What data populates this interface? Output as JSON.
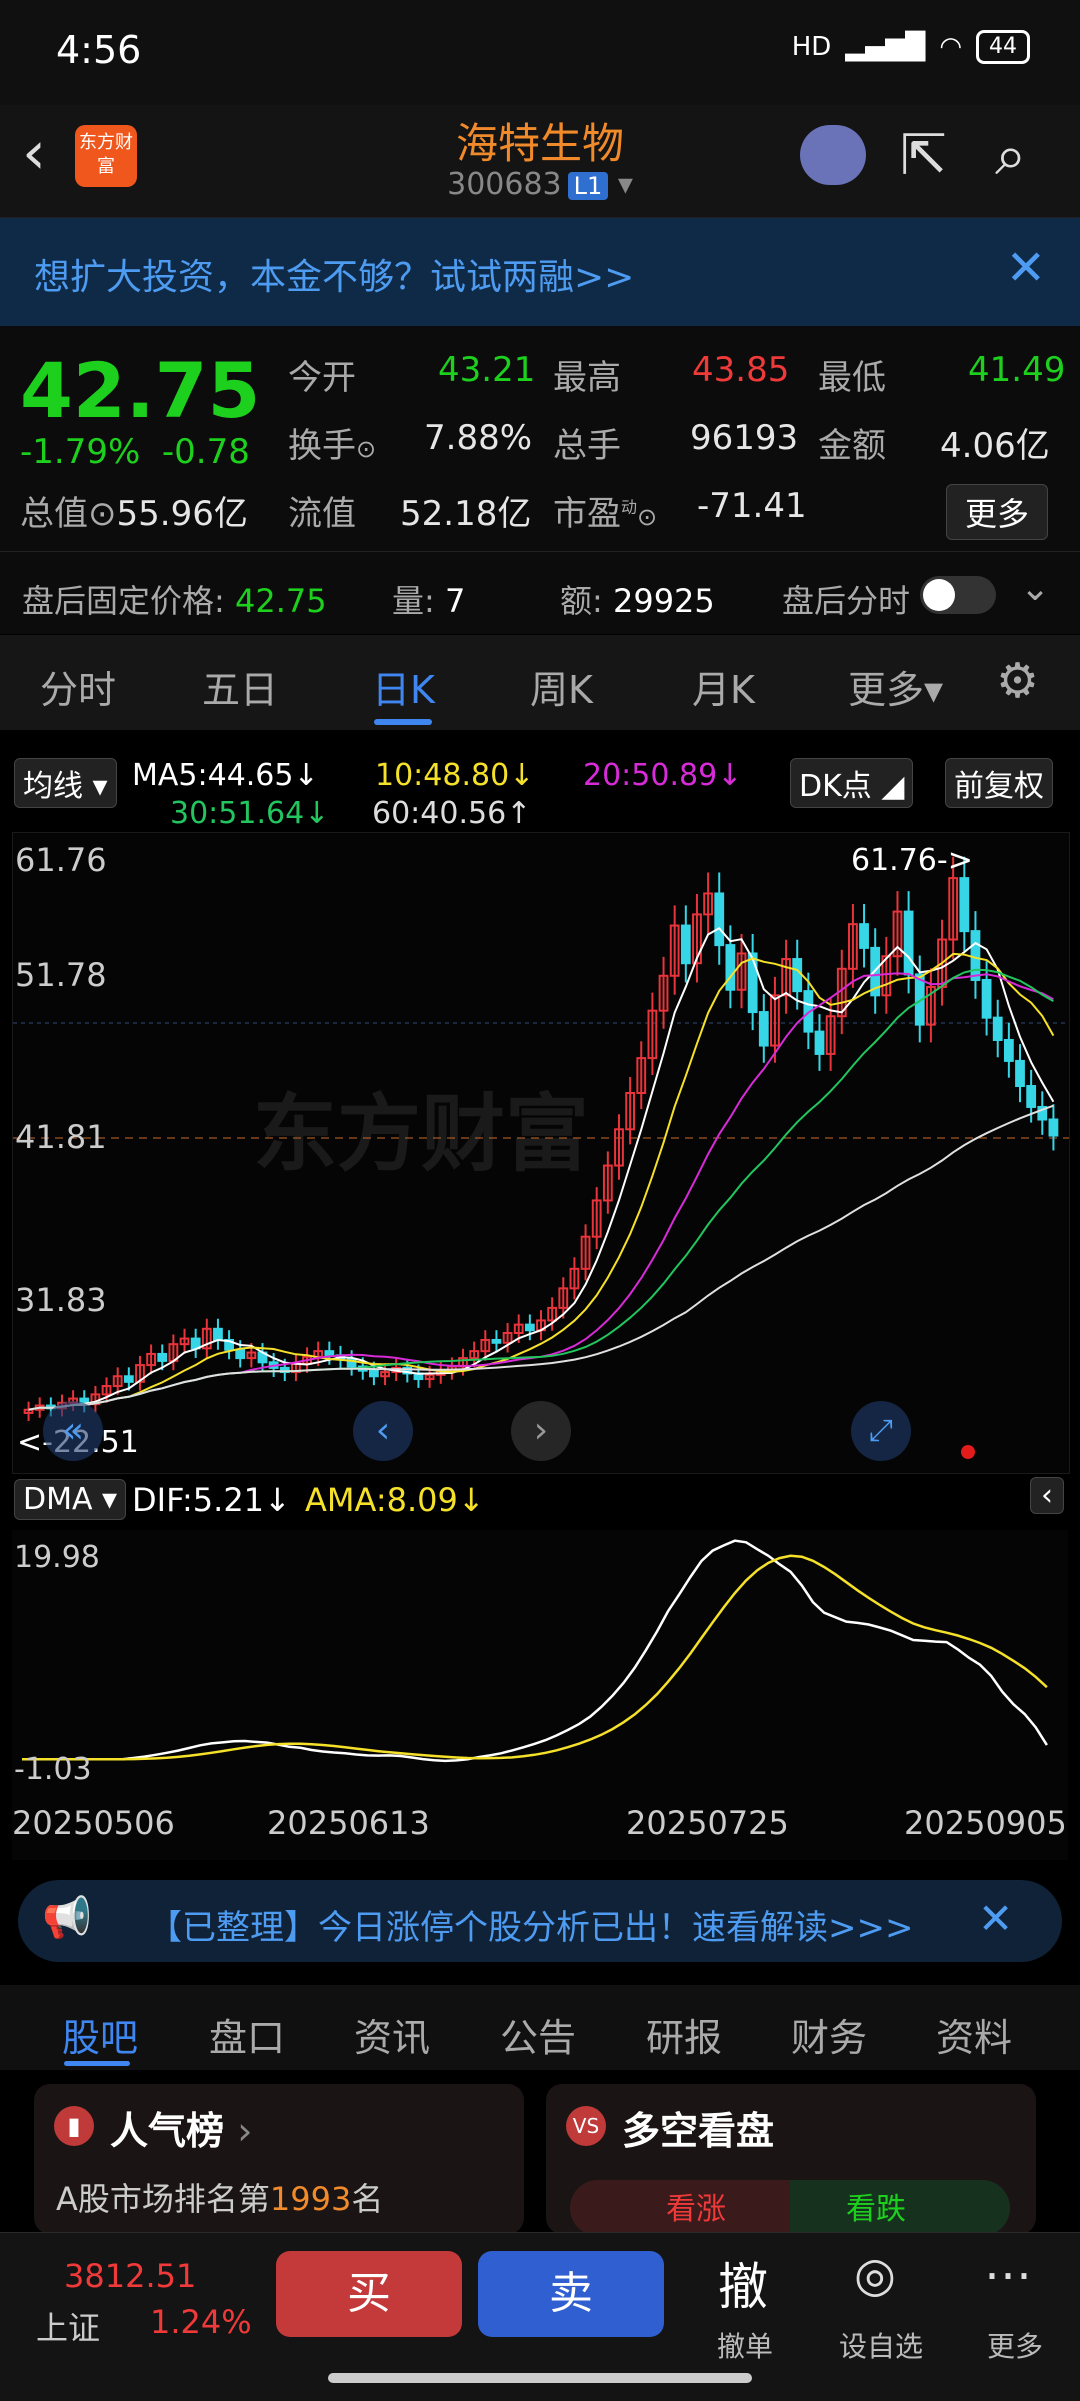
{
  "status": {
    "time": "4:56",
    "signal": "HD",
    "battery": "44"
  },
  "header": {
    "back_icon": "chevron-left",
    "logo_text": "东方财富",
    "title": "海特生物",
    "code": "300683",
    "level": "L1"
  },
  "banner": {
    "text": "想扩大投资，本金不够？试试两融>>"
  },
  "quote": {
    "price": "42.75",
    "change_pct": "-1.79%",
    "change": "-0.78",
    "open_label": "今开",
    "open": "43.21",
    "high_label": "最高",
    "high": "43.85",
    "low_label": "最低",
    "low": "41.49",
    "turnover_label": "换手",
    "turnover": "7.88%",
    "volume_label": "总手",
    "volume": "96193",
    "amount_label": "金额",
    "amount": "4.06亿",
    "mktcap_label": "总值",
    "mktcap": "55.96亿",
    "float_label": "流值",
    "float": "52.18亿",
    "pe_label": "市盈",
    "pe_sup": "动",
    "pe": "-71.41",
    "more": "更多"
  },
  "after_hours": {
    "price_label": "盘后固定价格:",
    "price": "42.75",
    "vol_label": "量:",
    "vol": "7",
    "amt_label": "额:",
    "amt": "29925",
    "timeshare_label": "盘后分时"
  },
  "tabs": [
    {
      "label": "分时"
    },
    {
      "label": "五日"
    },
    {
      "label": "日K"
    },
    {
      "label": "周K"
    },
    {
      "label": "月K"
    },
    {
      "label": "更多▾"
    }
  ],
  "ma": {
    "selector": "均线",
    "ma5": "MA5:44.65↓",
    "ma10": "10:48.80↓",
    "ma20": "20:50.89↓",
    "ma30": "30:51.64↓",
    "ma60": "60:40.56↑",
    "dk": "DK点",
    "adjust": "前复权"
  },
  "chart_data": {
    "type": "candlestick",
    "y_ticks": [
      "61.76",
      "51.78",
      "41.81",
      "31.83"
    ],
    "max_label": "61.76->",
    "min_label": "<-22.51",
    "current_line": "41.81",
    "x_ticks": [
      "20250506",
      "20250613",
      "20250725",
      "20250905"
    ],
    "closes": [
      23.1,
      23.4,
      23.2,
      23.6,
      23.9,
      23.5,
      24.2,
      24.8,
      25.5,
      25.1,
      26.3,
      27.1,
      26.6,
      27.8,
      28.2,
      27.5,
      28.9,
      28.1,
      27.4,
      26.8,
      27.2,
      26.5,
      26.1,
      25.8,
      26.4,
      26.9,
      27.3,
      27.0,
      26.7,
      26.2,
      25.9,
      25.5,
      25.8,
      26.1,
      25.7,
      25.3,
      25.6,
      25.9,
      26.2,
      26.8,
      27.3,
      28.1,
      27.9,
      28.6,
      29.2,
      28.8,
      29.5,
      30.4,
      31.8,
      33.2,
      35.5,
      38.1,
      40.6,
      43.2,
      45.8,
      48.3,
      51.7,
      54.2,
      57.8,
      55.1,
      58.6,
      60.1,
      56.4,
      53.2,
      55.8,
      51.6,
      49.2,
      52.8,
      55.4,
      53.1,
      50.2,
      48.6,
      51.3,
      54.7,
      57.9,
      56.2,
      52.8,
      55.6,
      58.8,
      54.3,
      50.7,
      53.4,
      56.8,
      61.2,
      57.4,
      53.9,
      51.2,
      49.6,
      48.1,
      46.3,
      44.8,
      43.9,
      42.75
    ]
  },
  "dma": {
    "selector": "DMA",
    "dif": "DIF:5.21↓",
    "ama": "AMA:8.09↓",
    "y_top": "19.98",
    "y_bottom": "-1.03"
  },
  "notice": {
    "text": "【已整理】今日涨停个股分析已出！速看解读>>>"
  },
  "bottom_tabs": [
    {
      "label": "股吧"
    },
    {
      "label": "盘口"
    },
    {
      "label": "资讯"
    },
    {
      "label": "公告"
    },
    {
      "label": "研报"
    },
    {
      "label": "财务"
    },
    {
      "label": "资料"
    }
  ],
  "cards": {
    "popular_title": "人气榜",
    "popular_text_pre": "A股市场排名第",
    "popular_rank": "1993",
    "popular_text_post": "名",
    "ls_title": "多空看盘",
    "bull": "看涨",
    "bear": "看跌"
  },
  "bottom": {
    "index_value": "3812.51",
    "index_name": "上证",
    "index_pct": "1.24%",
    "buy": "买",
    "sell": "卖",
    "cancel": "撤",
    "cancel_label": "撤单",
    "watch_label": "设自选",
    "more_label": "更多"
  }
}
